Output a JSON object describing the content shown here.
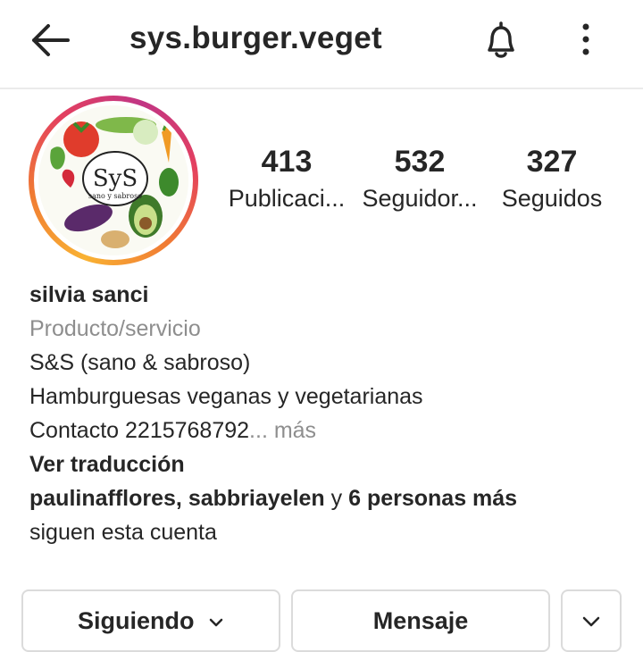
{
  "header": {
    "username": "sys.burger.veget"
  },
  "icons": {
    "back": "arrow-left-icon",
    "notifications": "bell-icon",
    "more": "more-vertical-icon"
  },
  "profile": {
    "avatar_text": {
      "logo": "SyS",
      "tagline": "sano y sabroso"
    },
    "stats": [
      {
        "value": "413",
        "label": "Publicaci..."
      },
      {
        "value": "532",
        "label": "Seguidor..."
      },
      {
        "value": "327",
        "label": "Seguidos"
      }
    ],
    "name": "silvia sanci",
    "category": "Producto/servicio",
    "bio_line1": "S&S  (sano & sabroso)",
    "bio_line2": "Hamburguesas veganas y vegetarianas",
    "bio_line3": "Contacto 2215768792",
    "more_link": "... más",
    "translate": "Ver traducción",
    "followed_by": {
      "user1": "paulinafflores",
      "separator": ", ",
      "user2": "sabbriayelen",
      "connector": " y ",
      "others": "6 personas más",
      "suffix": "siguen esta cuenta"
    }
  },
  "actions": {
    "following_label": "Siguiendo",
    "message_label": "Mensaje"
  },
  "colors": {
    "ring_start": "#f9b233",
    "ring_mid": "#e4405f",
    "ring_end": "#c13584",
    "text": "#262626",
    "muted": "#8e8e8e",
    "border": "#dbdbdb"
  }
}
